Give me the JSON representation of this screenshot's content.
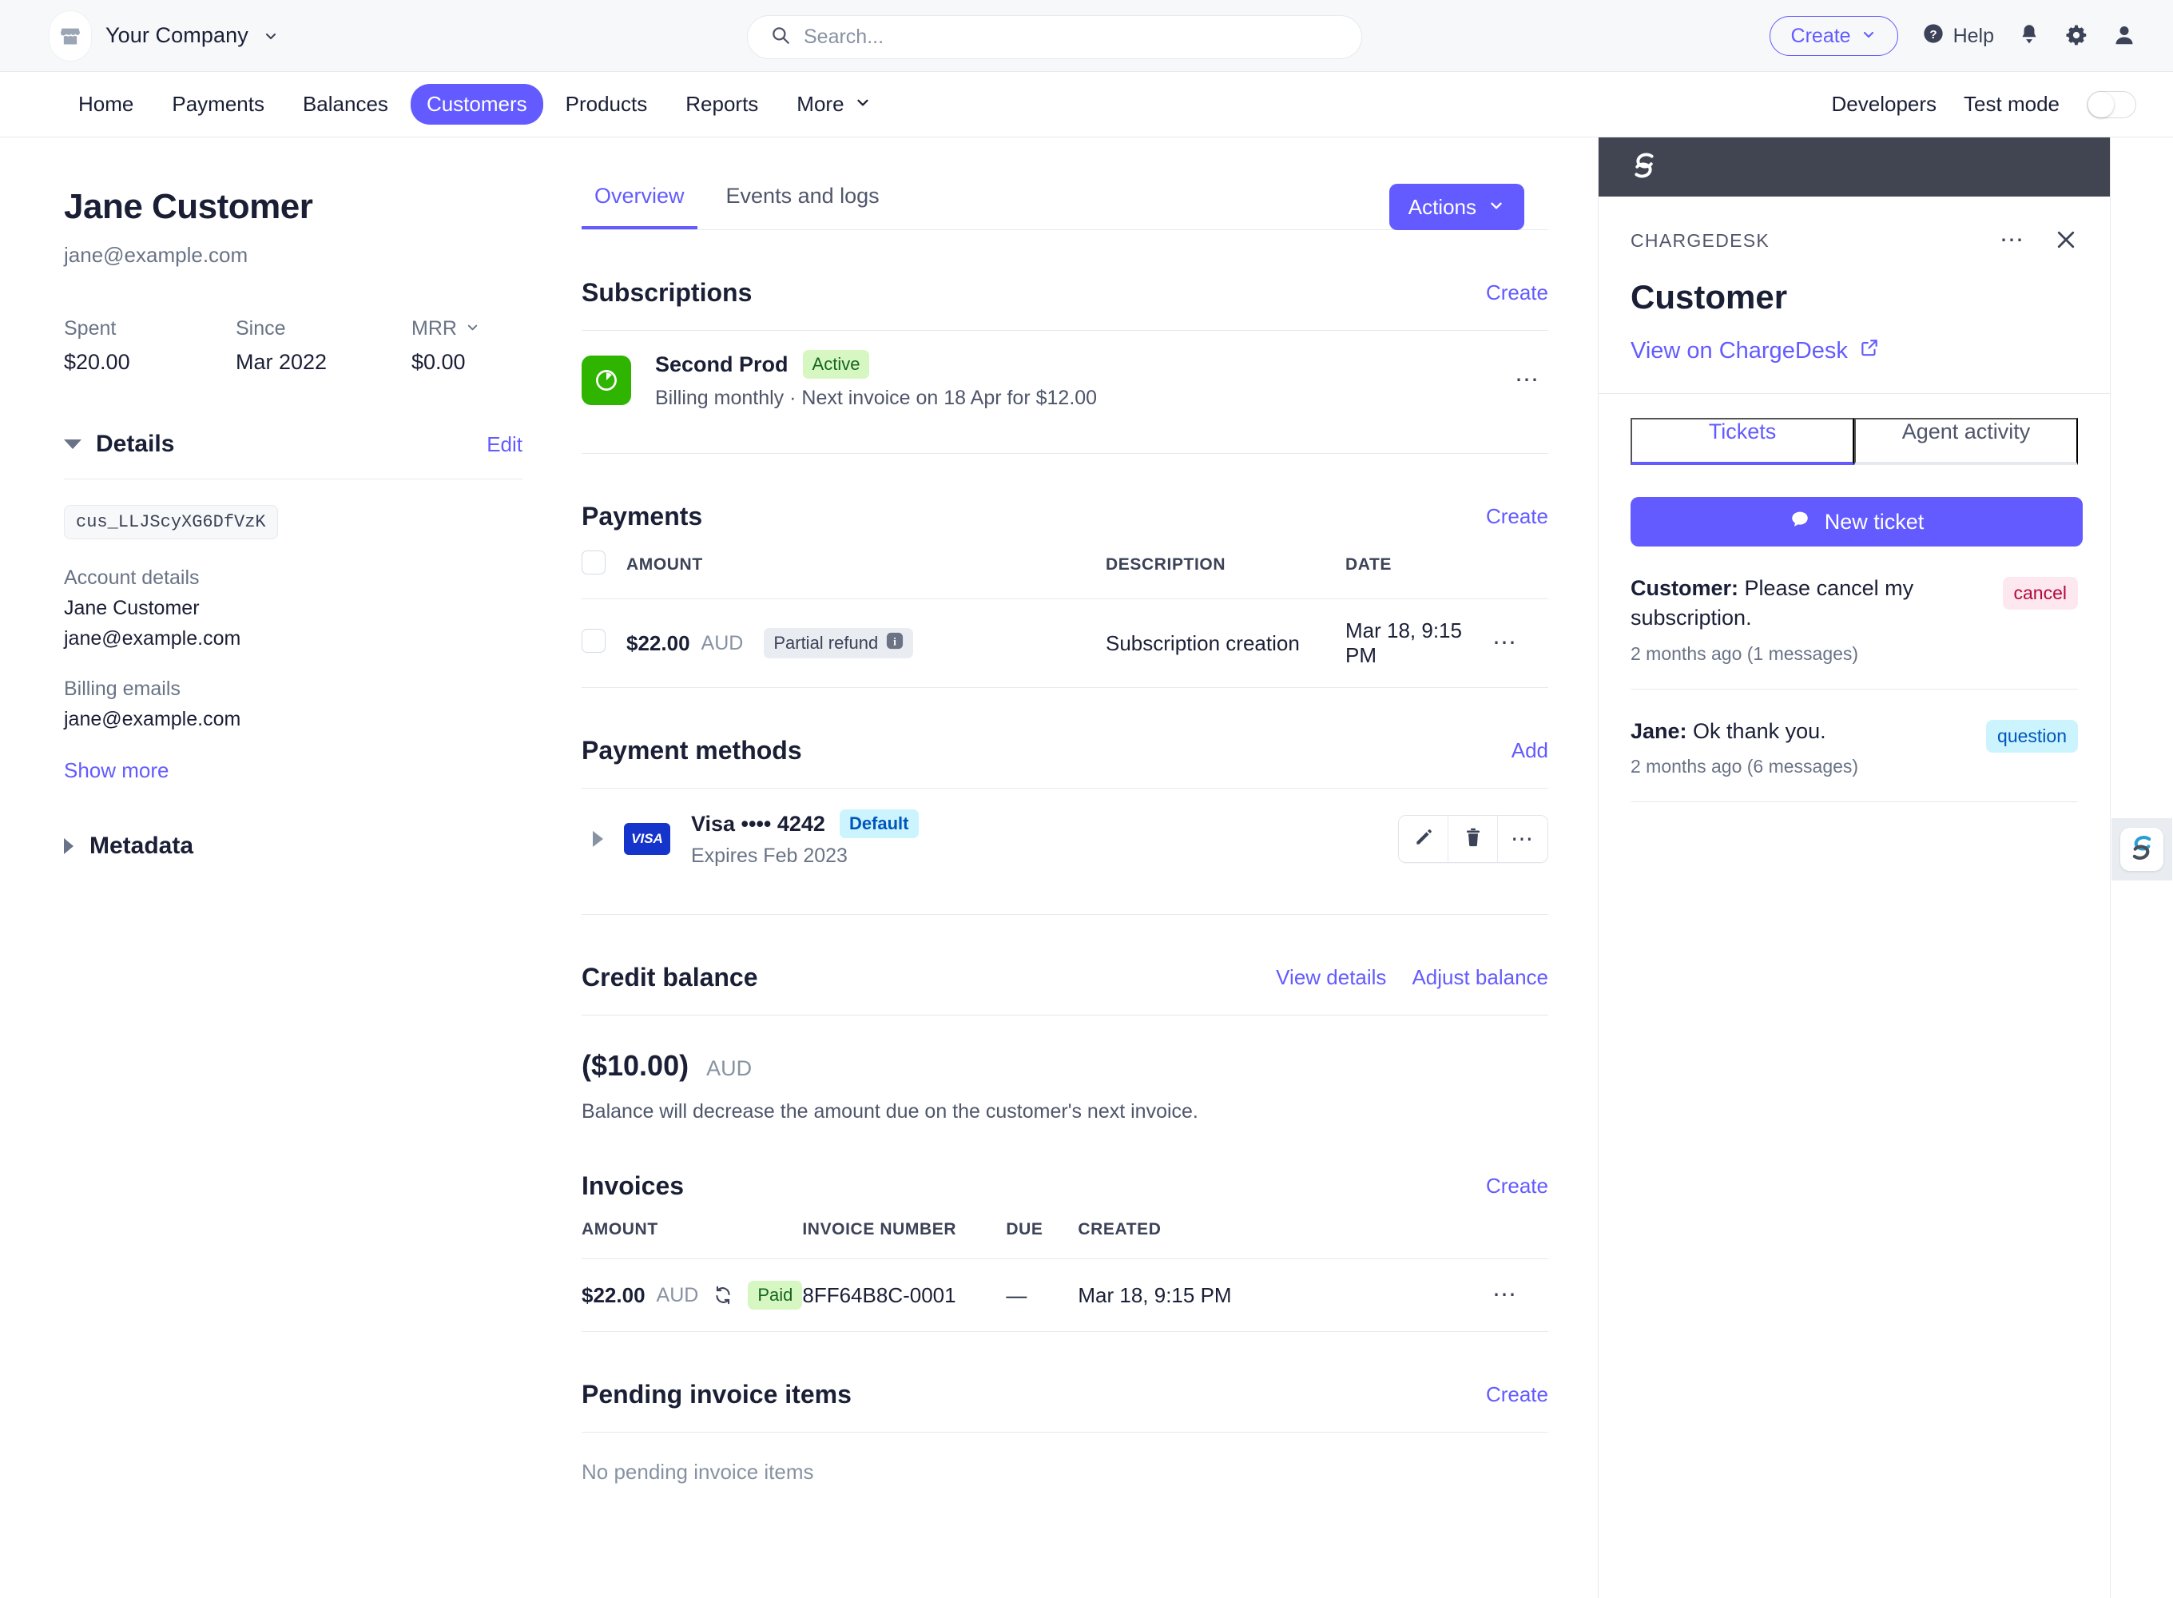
{
  "topbar": {
    "company": "Your Company",
    "search_placeholder": "Search...",
    "create_label": "Create",
    "help_label": "Help",
    "icons": [
      "store-icon",
      "search-icon",
      "chevron-down-icon",
      "help-icon",
      "bell-icon",
      "gear-icon",
      "user-icon"
    ]
  },
  "nav": {
    "items": [
      {
        "label": "Home",
        "active": false
      },
      {
        "label": "Payments",
        "active": false
      },
      {
        "label": "Balances",
        "active": false
      },
      {
        "label": "Customers",
        "active": true
      },
      {
        "label": "Products",
        "active": false
      },
      {
        "label": "Reports",
        "active": false
      },
      {
        "label": "More",
        "active": false,
        "has_chevron": true
      }
    ],
    "developers_label": "Developers",
    "test_mode_label": "Test mode",
    "test_mode_on": false
  },
  "customer": {
    "name": "Jane Customer",
    "email": "jane@example.com",
    "stats": [
      {
        "label": "Spent",
        "value": "$20.00",
        "dotted": true
      },
      {
        "label": "Since",
        "value": "Mar 2022",
        "dotted": false
      },
      {
        "label": "MRR",
        "value": "$0.00",
        "dotted": false,
        "has_chevron": true
      }
    ],
    "details_title": "Details",
    "details_edit": "Edit",
    "id": "cus_LLJScyXG6DfVzK",
    "fields": [
      {
        "label": "Account details",
        "values": [
          "Jane Customer",
          "jane@example.com"
        ]
      },
      {
        "label": "Billing emails",
        "values": [
          "jane@example.com"
        ]
      }
    ],
    "show_more": "Show more",
    "metadata_title": "Metadata"
  },
  "main": {
    "tabs": [
      {
        "label": "Overview",
        "active": true
      },
      {
        "label": "Events and logs",
        "active": false
      }
    ],
    "actions_label": "Actions",
    "subscriptions": {
      "title": "Subscriptions",
      "create_label": "Create",
      "rows": [
        {
          "name": "Second Prod",
          "status": "Active",
          "detail": "Billing monthly · Next invoice on 18 Apr for $12.00"
        }
      ]
    },
    "payments": {
      "title": "Payments",
      "create_label": "Create",
      "columns": [
        "AMOUNT",
        "DESCRIPTION",
        "DATE"
      ],
      "rows": [
        {
          "amount": "$22.00",
          "currency": "AUD",
          "badge": "Partial refund",
          "description": "Subscription creation",
          "date": "Mar 18, 9:15 PM"
        }
      ]
    },
    "payment_methods": {
      "title": "Payment methods",
      "add_label": "Add",
      "rows": [
        {
          "brand": "VISA",
          "label": "Visa •••• 4242",
          "badge": "Default",
          "expires": "Expires Feb 2023"
        }
      ]
    },
    "credit_balance": {
      "title": "Credit balance",
      "view_details_label": "View details",
      "adjust_balance_label": "Adjust balance",
      "amount": "($10.00)",
      "currency": "AUD",
      "note": "Balance will decrease the amount due on the customer's next invoice."
    },
    "invoices": {
      "title": "Invoices",
      "create_label": "Create",
      "columns": [
        "AMOUNT",
        "INVOICE NUMBER",
        "DUE",
        "CREATED"
      ],
      "rows": [
        {
          "amount": "$22.00",
          "currency": "AUD",
          "status": "Paid",
          "number": "8FF64B8C‑0001",
          "due": "—",
          "created": "Mar 18, 9:15 PM"
        }
      ]
    },
    "pending_invoice_items": {
      "title": "Pending invoice items",
      "create_label": "Create",
      "empty_text": "No pending invoice items"
    }
  },
  "panel": {
    "eyebrow": "CHARGEDESK",
    "title": "Customer",
    "view_link": "View on ChargeDesk",
    "tabs": [
      {
        "label": "Tickets",
        "active": true
      },
      {
        "label": "Agent activity",
        "active": false
      }
    ],
    "new_ticket_label": "New ticket",
    "tickets": [
      {
        "author": "Customer:",
        "text": " Please cancel my subscription.",
        "meta": "2 months ago (1 messages)",
        "tag": "cancel",
        "tag_kind": "cancel"
      },
      {
        "author": "Jane:",
        "text": " Ok thank you.",
        "meta": "2 months ago (6 messages)",
        "tag": "question",
        "tag_kind": "question"
      }
    ]
  },
  "colors": {
    "accent": "#635bff",
    "nav_active_bg": "#635bff",
    "panel_header_bg": "#414552",
    "success": "#2fb400",
    "badge_green_bg": "#d7f7c2",
    "badge_blue_bg": "#cbf4ff",
    "tag_cancel_bg": "#fde8ef",
    "visa_blue": "#1434CB"
  }
}
